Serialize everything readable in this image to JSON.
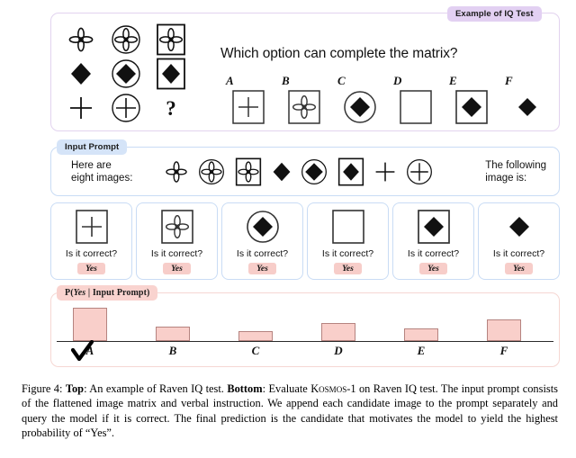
{
  "figure": {
    "top_panel": {
      "badge": "Example of IQ Test",
      "question": "Which option can complete the matrix?",
      "matrix": [
        [
          "flower-plain",
          "flower-in-circle",
          "flower-in-square"
        ],
        [
          "diamond-plain",
          "diamond-in-circle",
          "diamond-in-square"
        ],
        [
          "plus-plain",
          "plus-in-circle",
          "question-mark"
        ]
      ],
      "question_mark": "?",
      "options": [
        {
          "label": "A",
          "shape": "plus-in-square"
        },
        {
          "label": "B",
          "shape": "flower-in-square"
        },
        {
          "label": "C",
          "shape": "diamond-in-circle"
        },
        {
          "label": "D",
          "shape": "empty-square"
        },
        {
          "label": "E",
          "shape": "diamond-in-square"
        },
        {
          "label": "F",
          "shape": "diamond-plain"
        }
      ]
    },
    "prompt_panel": {
      "badge": "Input Prompt",
      "lead_text": "Here are\neight images:",
      "images": [
        "flower-plain",
        "flower-in-circle",
        "flower-in-square",
        "diamond-plain",
        "diamond-in-circle",
        "diamond-in-square",
        "plus-plain",
        "plus-in-circle"
      ],
      "trailing_text": "The following\nimage is:"
    },
    "candidates": [
      {
        "shape": "plus-in-square",
        "question": "Is it correct?",
        "answer": "Yes"
      },
      {
        "shape": "flower-in-square",
        "question": "Is it correct?",
        "answer": "Yes"
      },
      {
        "shape": "diamond-in-circle",
        "question": "Is it correct?",
        "answer": "Yes"
      },
      {
        "shape": "empty-square",
        "question": "Is it correct?",
        "answer": "Yes"
      },
      {
        "shape": "diamond-in-square",
        "question": "Is it correct?",
        "answer": "Yes"
      },
      {
        "shape": "diamond-plain",
        "question": "Is it correct?",
        "answer": "Yes"
      }
    ],
    "chart_panel": {
      "badge_prefix": "P(",
      "badge_yes": "Yes",
      "badge_middle": "|",
      "badge_cond": "Input Prompt",
      "badge_suffix": ")",
      "selected": "A",
      "selected_marker": "check-mark"
    },
    "caption": {
      "figure_number": "Figure 4:",
      "bold_top": "Top",
      "text_1": ": An example of Raven IQ test. ",
      "bold_bottom": "Bottom",
      "text_2": ": Evaluate ",
      "model_name": "Kosmos-1",
      "text_3": " on Raven IQ test. The input prompt consists of the flattened image matrix and verbal instruction. We append each candidate image to the prompt separately and query the model if it is correct. The final prediction is the candidate that motivates the model to yield the highest probability of “Yes”."
    },
    "colors": {
      "badge_iq": "#e2d0f2",
      "badge_prompt": "#d5e4f8",
      "badge_prob": "#f9d3cf",
      "bar_fill": "#f9cfca",
      "bar_stroke": "#b5837f",
      "yes_badge": "#f7cdc9"
    }
  },
  "chart_data": {
    "type": "bar",
    "title": "P( Yes | Input Prompt )",
    "categories": [
      "A",
      "B",
      "C",
      "D",
      "E",
      "F"
    ],
    "values": [
      0.92,
      0.4,
      0.27,
      0.5,
      0.35,
      0.58
    ],
    "xlabel": "",
    "ylabel": "",
    "ylim": [
      0,
      1
    ],
    "grid": false,
    "legend": "none",
    "highlight": "A",
    "note": "A is the highest-probability candidate and is marked with a check"
  }
}
